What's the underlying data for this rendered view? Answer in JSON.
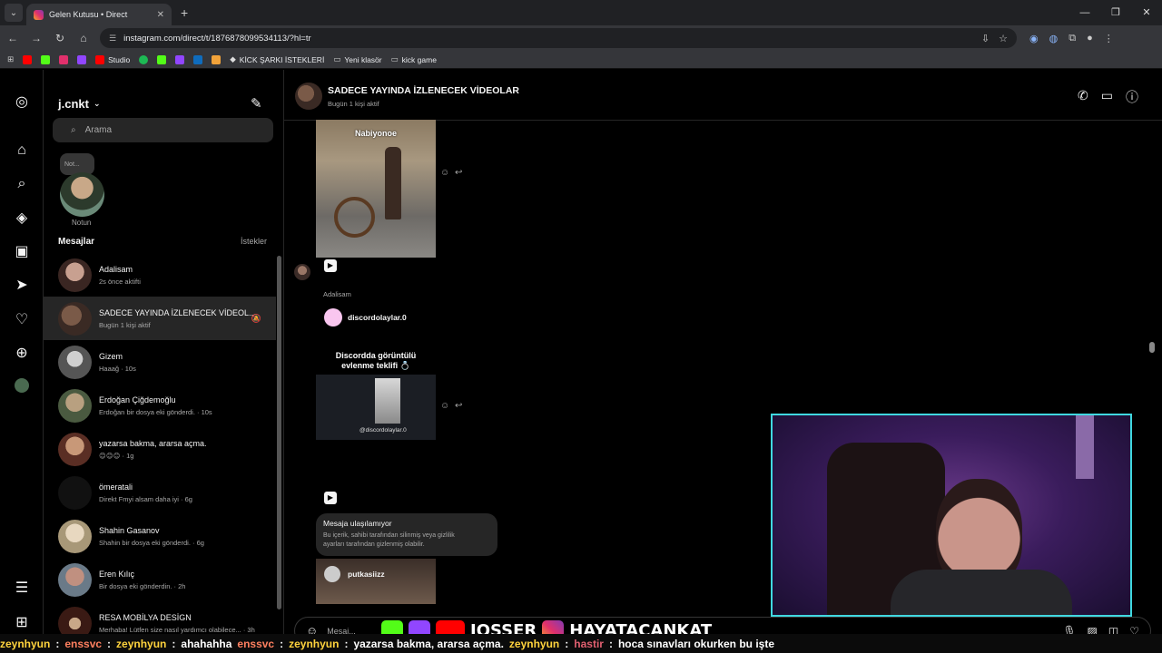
{
  "browser": {
    "tab_title": "Gelen Kutusu • Direct",
    "url": "instagram.com/direct/t/1876878099534113/?hl=tr",
    "bookmarks": [
      "Studio",
      "KİCK ŞARKI İSTEKLERİ",
      "Yeni klasör",
      "kick game"
    ]
  },
  "inbox": {
    "username": "j.cnkt",
    "search_placeholder": "Arama",
    "note_bubble": "Not...",
    "note_label": "Notun",
    "messages_title": "Mesajlar",
    "requests_label": "İstekler",
    "threads": [
      {
        "name": "Adalisam",
        "sub": "2s önce aktifti"
      },
      {
        "name": "SADECE YAYINDA İZLENECEK VİDEOL...",
        "sub": "Bugün 1 kişi aktif"
      },
      {
        "name": "Gizem",
        "sub": "Haaağ · 10s"
      },
      {
        "name": "Erdoğan Çiğdemoğlu",
        "sub": "Erdoğan bir dosya eki gönderdi. · 10s"
      },
      {
        "name": "yazarsa bakma, ararsa açma.",
        "sub": "😊😊😊 · 1g"
      },
      {
        "name": "ömeratali",
        "sub": "Direkt Fmyi alsam daha iyi · 6g"
      },
      {
        "name": "Shahin Gasanov",
        "sub": "Shahin bir dosya eki gönderdi. · 6g"
      },
      {
        "name": "Eren Kılıç",
        "sub": "Bir dosya eki gönderdin. · 2h"
      },
      {
        "name": "RESA MOBİLYA DESİGN",
        "sub": "Merhaba! Lütfen size nasıl yardımcı olabilece... · 3h"
      }
    ]
  },
  "chat": {
    "title": "SADECE YAYINDA İZLENECEK VİDEOLAR",
    "subtitle": "Bugün 1 kişi aktif",
    "media1_caption": "Nabiyonoe",
    "sender": "Adalisam",
    "shared_account": "discordolaylar.0",
    "media2_caption_line1": "Discordda görüntülü",
    "media2_caption_line2": "evlenme teklifi 💍",
    "media2_watermark": "@discordolaylar.0",
    "unavailable_title": "Mesaja ulaşılamıyor",
    "unavailable_desc_line1": "Bu içerik, sahibi tarafından silinmiş veya gizlilik",
    "unavailable_desc_line2": "ayarları tarafından gizlenmiş olabilir.",
    "media3_account": "putkasiizz",
    "composer_placeholder": "Mesaj..."
  },
  "stream": {
    "brands": [
      "JOSSER",
      "HAYATACANKAT"
    ],
    "ticker": [
      {
        "user": "zeynhyun",
        "msg": ""
      },
      {
        "user": "enssvc",
        "msg": ""
      },
      {
        "user": "zeynhyun",
        "msg": "ahahahha"
      },
      {
        "user": "enssvc",
        "msg": ""
      },
      {
        "user": "zeynhyun",
        "msg": "yazarsa bakma, ararsa açma."
      },
      {
        "user": "zeynhyun",
        "msg": ""
      },
      {
        "user": "hastir",
        "msg": "hoca sınavları okurken bu işte"
      }
    ]
  },
  "colors": {
    "accent_cyan": "#40d8e0",
    "active_row": "#262626"
  }
}
